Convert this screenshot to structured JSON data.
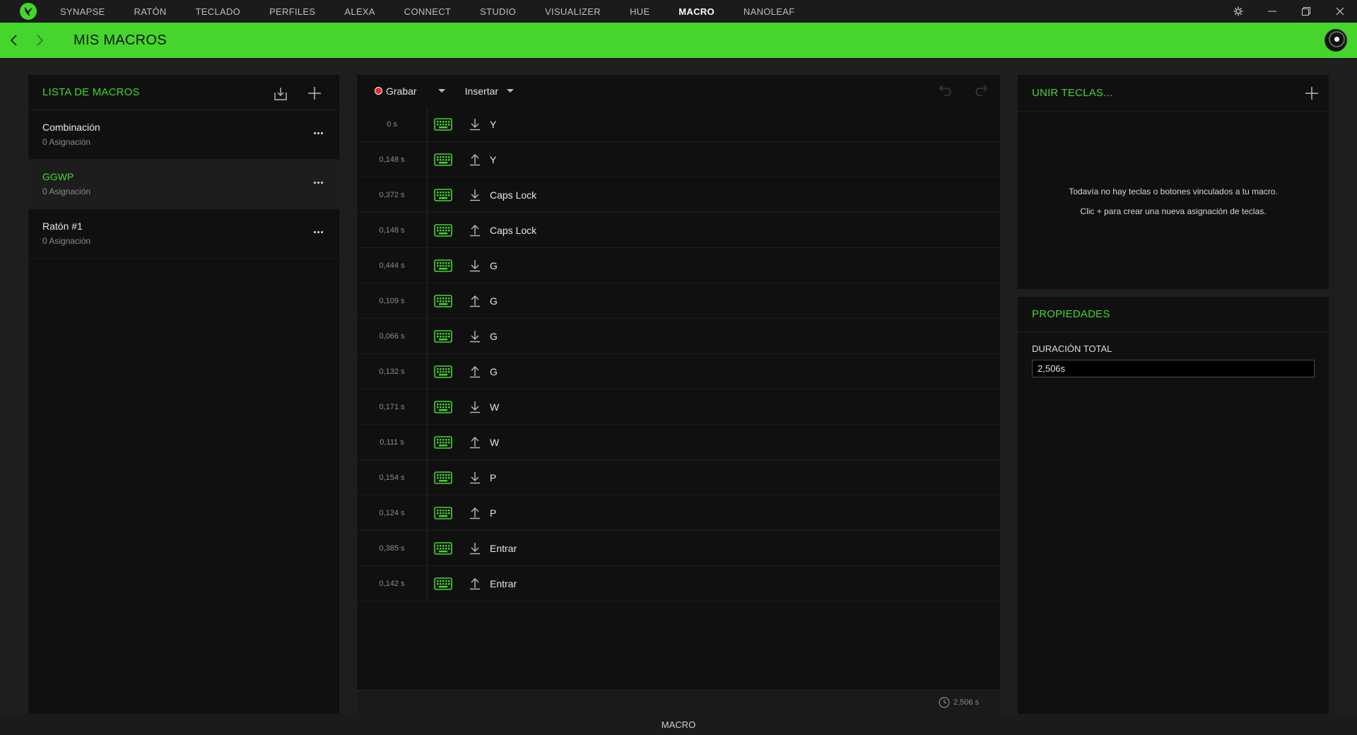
{
  "nav": {
    "items": [
      "SYNAPSE",
      "RATÓN",
      "TECLADO",
      "PERFILES",
      "ALEXA",
      "CONNECT",
      "STUDIO",
      "VISUALIZER",
      "HUE",
      "MACRO",
      "NANOLEAF"
    ],
    "active": "MACRO"
  },
  "header": {
    "title": "MIS MACROS"
  },
  "macro_list": {
    "title": "LISTA DE MACROS",
    "items": [
      {
        "name": "Combinación",
        "sub": "0 Asignación",
        "selected": false
      },
      {
        "name": "GGWP",
        "sub": "0 Asignación",
        "selected": true
      },
      {
        "name": "Ratón #1",
        "sub": "0 Asignación",
        "selected": false
      }
    ]
  },
  "toolbar": {
    "record_label": "Grabar",
    "insert_label": "Insertar"
  },
  "events": [
    {
      "time": "0 s",
      "dir": "down",
      "key": "Y"
    },
    {
      "time": "0,148 s",
      "dir": "up",
      "key": "Y"
    },
    {
      "time": "0,372 s",
      "dir": "down",
      "key": "Caps Lock"
    },
    {
      "time": "0,148 s",
      "dir": "up",
      "key": "Caps Lock"
    },
    {
      "time": "0,444 s",
      "dir": "down",
      "key": "G"
    },
    {
      "time": "0,109 s",
      "dir": "up",
      "key": "G"
    },
    {
      "time": "0,066 s",
      "dir": "down",
      "key": "G"
    },
    {
      "time": "0,132 s",
      "dir": "up",
      "key": "G"
    },
    {
      "time": "0,171 s",
      "dir": "down",
      "key": "W"
    },
    {
      "time": "0,111 s",
      "dir": "up",
      "key": "W"
    },
    {
      "time": "0,154 s",
      "dir": "down",
      "key": "P"
    },
    {
      "time": "0,124 s",
      "dir": "up",
      "key": "P"
    },
    {
      "time": "0,385 s",
      "dir": "down",
      "key": "Entrar"
    },
    {
      "time": "0,142 s",
      "dir": "up",
      "key": "Entrar"
    }
  ],
  "footer": {
    "total_small": "2,506 s"
  },
  "bind_keys": {
    "title": "UNIR TECLAS...",
    "empty_line1": "Todavía no hay teclas o botones vinculados a tu macro.",
    "empty_line2": "Clic + para crear una nueva asignación de teclas."
  },
  "properties": {
    "title": "PROPIEDADES",
    "duration_label": "DURACIÓN TOTAL",
    "duration_value": "2,506s"
  },
  "bottom_bar": {
    "label": "MACRO"
  },
  "colors": {
    "accent": "#44d62c",
    "panel": "#101010",
    "background": "#1e1e1e",
    "record": "#e3262b"
  }
}
